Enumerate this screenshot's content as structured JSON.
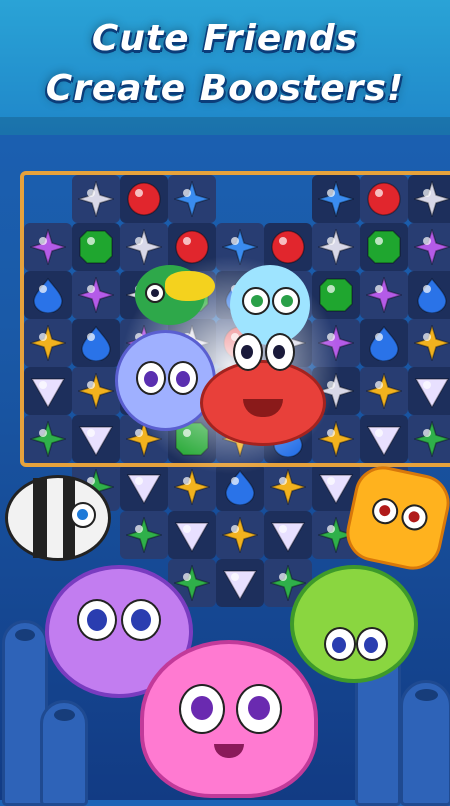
{
  "title": {
    "line1": "Cute Friends",
    "line2": "Create Boosters!"
  },
  "colors": {
    "banner": "#2aa3d6",
    "board_frame": "#e6a23c",
    "background": "#1a5aa8"
  },
  "board": {
    "rows": [
      [
        "",
        "star-silver",
        "gem-red",
        "star-blue",
        "",
        "",
        "star-blue",
        "gem-red",
        "star-silver",
        ""
      ],
      [
        "star-purple",
        "gem-green",
        "star-silver",
        "gem-red",
        "star-blue",
        "gem-red",
        "star-silver",
        "gem-green",
        "star-purple",
        ""
      ],
      [
        "gem-blue",
        "star-purple",
        "star-silver",
        "gem-green",
        "gem-blue",
        "star-silver",
        "gem-green",
        "star-purple",
        "gem-blue",
        ""
      ],
      [
        "star-gold",
        "gem-blue",
        "star-purple",
        "star-silver",
        "gem-red",
        "star-silver",
        "star-purple",
        "gem-blue",
        "star-gold",
        ""
      ],
      [
        "tri-white",
        "star-gold",
        "gem-blue",
        "star-silver",
        "star-gold",
        "gem-red",
        "star-silver",
        "star-gold",
        "tri-white",
        ""
      ],
      [
        "star-green",
        "tri-white",
        "star-gold",
        "gem-green",
        "star-gold",
        "gem-blue",
        "star-gold",
        "tri-white",
        "star-green",
        ""
      ],
      [
        "",
        "star-green",
        "tri-white",
        "star-gold",
        "gem-blue",
        "star-gold",
        "tri-white",
        "star-green",
        "",
        ""
      ],
      [
        "",
        "",
        "star-green",
        "tri-white",
        "star-gold",
        "tri-white",
        "star-green",
        "",
        "",
        ""
      ],
      [
        "",
        "",
        "",
        "star-green",
        "tri-white",
        "star-green",
        "",
        "",
        "",
        ""
      ]
    ]
  },
  "characters": [
    {
      "name": "toucan",
      "color": "#f4d21e"
    },
    {
      "name": "seahorse",
      "color": "#9ee4ff"
    },
    {
      "name": "octopus",
      "color": "#9fb0ff"
    },
    {
      "name": "crab",
      "color": "#e8403a"
    },
    {
      "name": "angelfish",
      "color": "#f2f2f2"
    },
    {
      "name": "starfish",
      "color": "#ffb21e"
    },
    {
      "name": "pufferfish",
      "color": "#c27df0"
    },
    {
      "name": "hermit-crab",
      "color": "#8ad640"
    },
    {
      "name": "jellyfish",
      "color": "#ff7ad1"
    }
  ]
}
